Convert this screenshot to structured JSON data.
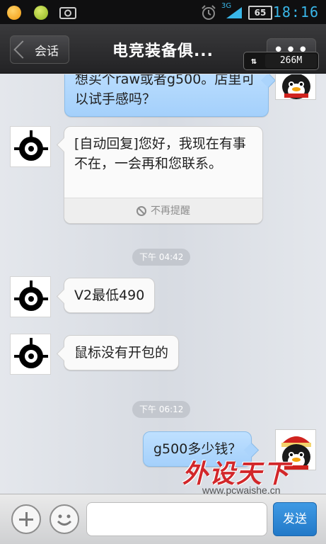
{
  "status_bar": {
    "network": "3G",
    "battery": "65",
    "time": "18:16",
    "icons": [
      "orange-circle-icon",
      "gamepad-icon",
      "screenshot-icon",
      "alarm-icon",
      "signal-icon",
      "battery-icon"
    ]
  },
  "header": {
    "back_label": "会话",
    "title": "电竞装备俱...",
    "more_label": "•••",
    "memory": "266M"
  },
  "messages": [
    {
      "side": "right",
      "text": "想买个raw或者g500。店里可以试手感吗？"
    },
    {
      "side": "left",
      "text": "[自动回复]您好，我现在有事不在，一会再和您联系。",
      "footer": "不再提醒"
    },
    {
      "type": "time",
      "text": "下午 04:42"
    },
    {
      "side": "left",
      "text": "V2最低490"
    },
    {
      "side": "left",
      "text": "鼠标没有开包的"
    },
    {
      "type": "time",
      "text": "下午 06:12"
    },
    {
      "side": "right",
      "text": "g500多少钱？"
    }
  ],
  "input_bar": {
    "input_value": "",
    "send_label": "发送"
  },
  "watermark": {
    "brand": "外设天下",
    "url": "www.pcwaishe.cn"
  },
  "colors": {
    "accent": "#39b6e8",
    "bubble_out": "#a4d0fb",
    "bubble_in": "#fafafa",
    "send": "#2a85d4"
  }
}
